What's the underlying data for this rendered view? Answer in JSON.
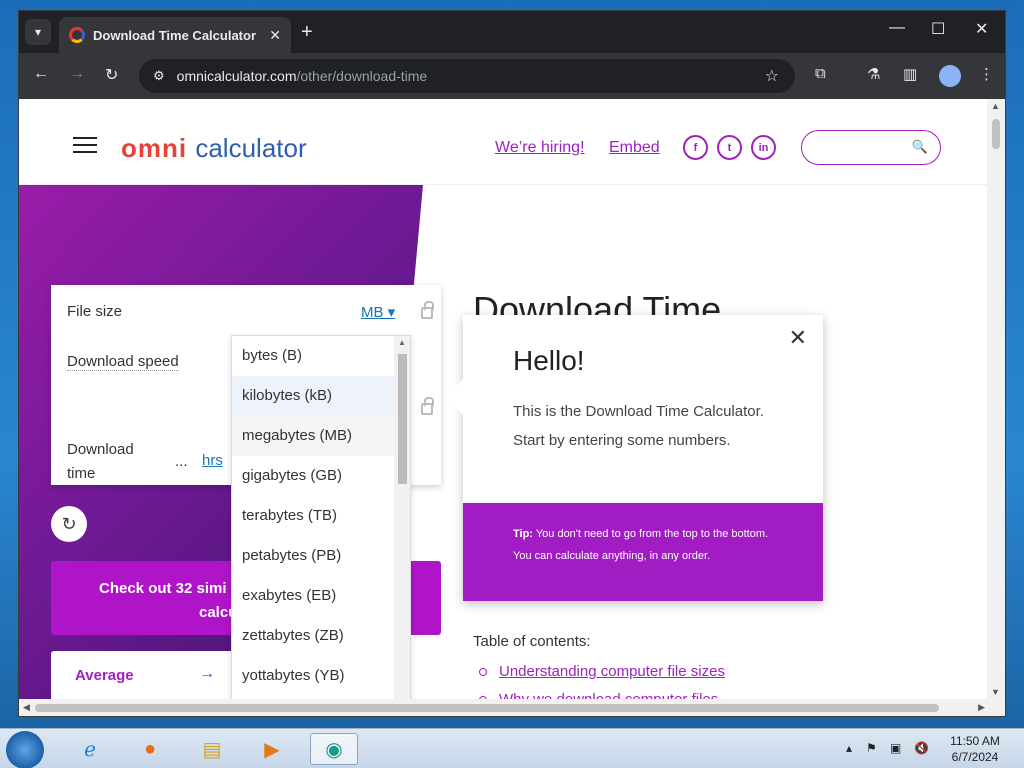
{
  "browser": {
    "tab_title": "Download Time Calculator",
    "tab_close": "✕",
    "new_tab": "+",
    "url_host": "omnicalculator.com",
    "url_path": "/other/download-time"
  },
  "header": {
    "logo_omni": "omni",
    "logo_calc": "calculator",
    "hiring": "We’re hiring!",
    "embed": "Embed",
    "social": [
      "f",
      "t",
      "in"
    ]
  },
  "calculator": {
    "file_size_label": "File size",
    "file_size_unit": "MB ▾",
    "download_speed_label": "Download speed",
    "download_time_label_1": "Download",
    "download_time_label_2": "time",
    "download_time_dots": "...",
    "download_time_unit": "hrs"
  },
  "dropdown": {
    "options": [
      "bytes (B)",
      "kilobytes (kB)",
      "megabytes (MB)",
      "gigabytes (GB)",
      "terabytes (TB)",
      "petabytes (PB)",
      "exabytes (EB)",
      "zettabytes (ZB)",
      "yottabytes (YB)"
    ]
  },
  "promo": {
    "checkout_line1": "Check out 32 simi",
    "checkout_line2": "calcu",
    "average": "Average",
    "arrow": "→"
  },
  "article": {
    "title": "Download Time",
    "toc_title": "Table of contents:",
    "toc": [
      "Understanding computer file sizes",
      "Why we download computer files"
    ]
  },
  "popup": {
    "heading": "Hello!",
    "message": "This is the Download Time Calculator. Start by entering some numbers.",
    "tip_label": "Tip:",
    "tip_text": "You don't need to go from the top to the bottom.",
    "tip_text2": "You can calculate anything, in any order."
  },
  "taskbar": {
    "time": "11:50 AM",
    "date": "6/7/2024"
  },
  "colors": {
    "accent": "#a020c0",
    "unit_link": "#1677b3"
  }
}
